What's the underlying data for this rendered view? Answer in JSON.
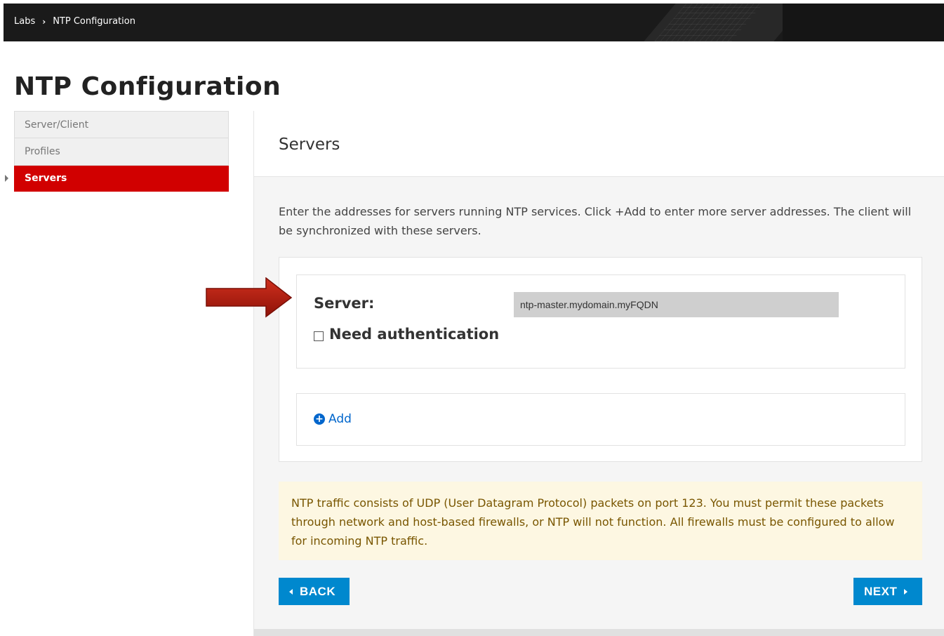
{
  "breadcrumb": {
    "root": "Labs",
    "current": "NTP Configuration"
  },
  "page_title": "NTP Configuration",
  "nav": {
    "items": [
      {
        "label": "Server/Client",
        "active": false
      },
      {
        "label": "Profiles",
        "active": false
      },
      {
        "label": "Servers",
        "active": true
      }
    ]
  },
  "panel": {
    "title": "Servers",
    "intro": "Enter the addresses for servers running NTP services. Click +Add to enter more server addresses. The client will be synchronized with these servers.",
    "server_label": "Server:",
    "server_value": "ntp-master.mydomain.myFQDN",
    "auth_label": "Need authentication",
    "auth_checked": false,
    "add_label": "Add",
    "note": "NTP traffic consists of UDP (User Datagram Protocol) packets on port 123. You must permit these packets through network and host-based firewalls, or NTP will not function. All firewalls must be configured to allow for incoming NTP traffic."
  },
  "buttons": {
    "back": "BACK",
    "next": "NEXT"
  },
  "colors": {
    "active_nav": "#d10000",
    "primary_button": "#0088ce",
    "link": "#0066cc",
    "note_bg": "#fdf7e2",
    "annotation_arrow": "#b01c10"
  },
  "icons": {
    "breadcrumb_separator": "chevron-right-icon",
    "add": "plus-circle-icon",
    "back": "caret-left-icon",
    "next": "caret-right-icon",
    "annotation": "red-arrow-icon"
  }
}
